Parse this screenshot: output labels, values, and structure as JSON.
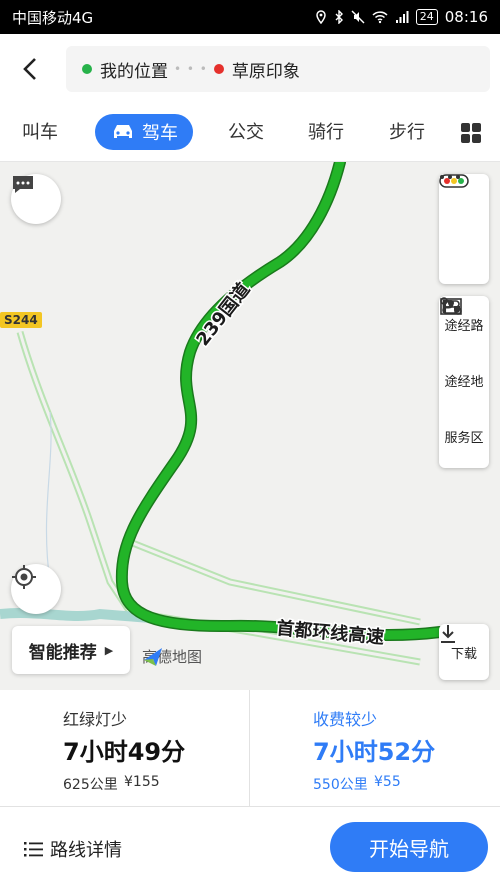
{
  "status_bar": {
    "carrier": "中国移动4G",
    "battery": "24",
    "time": "08:16",
    "icons": [
      "location-icon",
      "bluetooth-icon",
      "mute-icon",
      "wifi-icon",
      "signal-icon",
      "battery-icon"
    ]
  },
  "route": {
    "origin": "我的位置",
    "destination": "草原印象"
  },
  "tabs": {
    "call": "叫车",
    "drive": "驾车",
    "bus": "公交",
    "bike": "骑行",
    "walk": "步行"
  },
  "map": {
    "road_badge": "S244",
    "road_label_1": "239国道",
    "road_label_2": "首都环线高速",
    "side_buttons": {
      "waypoint_route": "途经路",
      "waypoint_place": "途经地",
      "service_area": "服务区"
    },
    "smart_recommend": "智能推荐",
    "logo_text": "高德地图",
    "download": "下载",
    "route_color": "#22b428",
    "accent": "#2f7cf6"
  },
  "cards": [
    {
      "tag": "红绿灯少",
      "duration": "7小时49分",
      "distance": "625公里",
      "cost": "¥155"
    },
    {
      "tag": "收费较少",
      "duration": "7小时52分",
      "distance": "550公里",
      "cost": "¥55"
    }
  ],
  "footer": {
    "details": "路线详情",
    "start": "开始导航"
  }
}
